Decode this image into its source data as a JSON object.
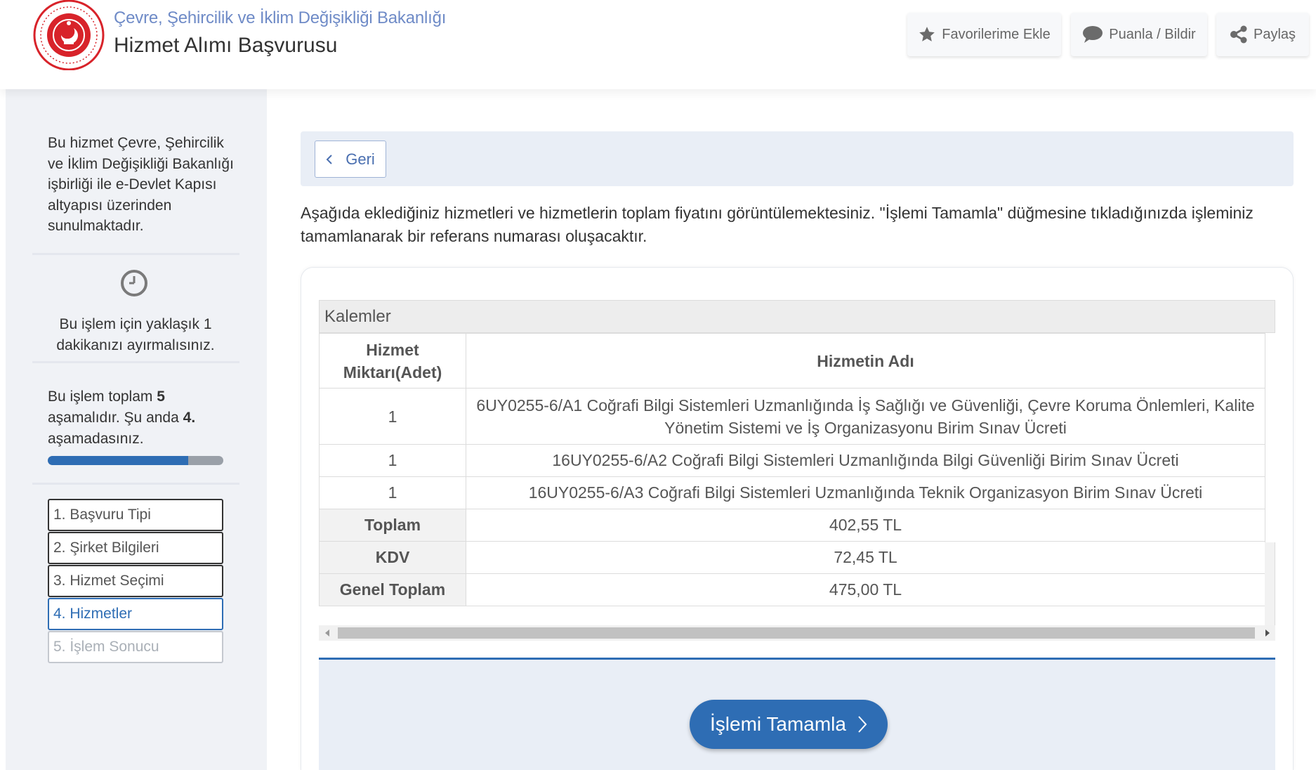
{
  "header": {
    "ministry": "Çevre, Şehircilik ve İklim Değişikliği Bakanlığı",
    "title": "Hizmet Alımı Başvurusu",
    "buttons": {
      "favorite": "Favorilerime Ekle",
      "rate": "Puanla / Bildir",
      "share": "Paylaş"
    }
  },
  "sidebar": {
    "info": "Bu hizmet Çevre, Şehircilik ve İklim Değişikliği Bakanlığı işbirliği ile e-Devlet Kapısı altyapısı üzerinden sunulmaktadır.",
    "time_note": "Bu işlem için yaklaşık 1 dakikanızı ayırmalısınız.",
    "steps_prefix": "Bu işlem toplam",
    "steps_total": "5",
    "steps_middle": "aşamalıdır. Şu anda",
    "steps_current": "4.",
    "steps_suffix": "aşamadasınız.",
    "progress_fraction": 0.8,
    "steps": [
      {
        "label": "1. Başvuru Tipi",
        "state": "done"
      },
      {
        "label": "2. Şirket Bilgileri",
        "state": "done"
      },
      {
        "label": "3. Hizmet Seçimi",
        "state": "done"
      },
      {
        "label": "4. Hizmetler",
        "state": "active"
      },
      {
        "label": "5. İşlem Sonucu",
        "state": "disabled"
      }
    ]
  },
  "main": {
    "back_label": "Geri",
    "intro": "Aşağıda eklediğiniz hizmetleri ve hizmetlerin toplam fiyatını görüntülemektesiniz. \"İşlemi Tamamla\" düğmesine tıkladığınızda işleminiz tamamlanarak bir referans numarası oluşacaktır.",
    "table": {
      "caption": "Kalemler",
      "headers": [
        "Hizmet Miktarı(Adet)",
        "Hizmetin Adı"
      ],
      "rows": [
        {
          "qty": "1",
          "name": "6UY0255-6/A1 Coğrafi Bilgi Sistemleri Uzmanlığında İş Sağlığı ve Güvenliği, Çevre Koruma Önlemleri, Kalite Yönetim Sistemi ve İş Organizasyonu Birim Sınav Ücreti"
        },
        {
          "qty": "1",
          "name": "16UY0255-6/A2 Coğrafi Bilgi Sistemleri Uzmanlığında Bilgi Güvenliği Birim Sınav Ücreti"
        },
        {
          "qty": "1",
          "name": "16UY0255-6/A3 Coğrafi Bilgi Sistemleri Uzmanlığında Teknik Organizasyon Birim Sınav Ücreti"
        }
      ],
      "totals": [
        {
          "label": "Toplam",
          "value": "402,55 TL"
        },
        {
          "label": "KDV",
          "value": "72,45 TL"
        },
        {
          "label": "Genel Toplam",
          "value": "475,00 TL"
        }
      ]
    },
    "complete_label": "İşlemi Tamamla"
  },
  "colors": {
    "primary": "#2e6db4",
    "ministry_text": "#6f8bc7",
    "panel_bg": "#e9eef6",
    "sidebar_bg": "#f0f2f6",
    "logo_red": "#d8232a"
  },
  "icons": [
    "ministry-logo",
    "star-icon",
    "comment-icon",
    "share-icon",
    "clock-icon",
    "chevron-left-icon",
    "chevron-right-icon"
  ]
}
